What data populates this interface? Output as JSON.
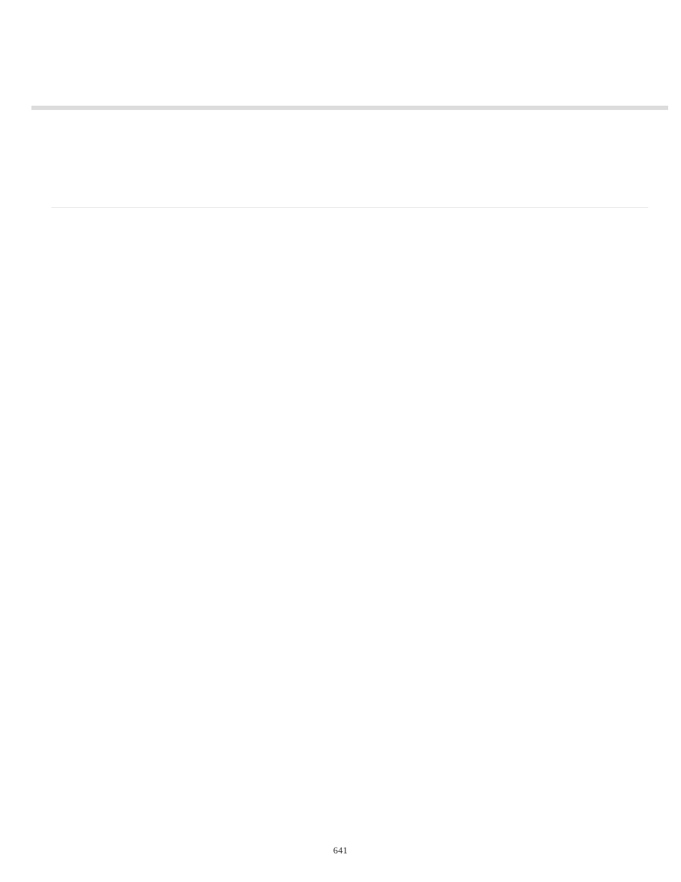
{
  "page_number": "641"
}
